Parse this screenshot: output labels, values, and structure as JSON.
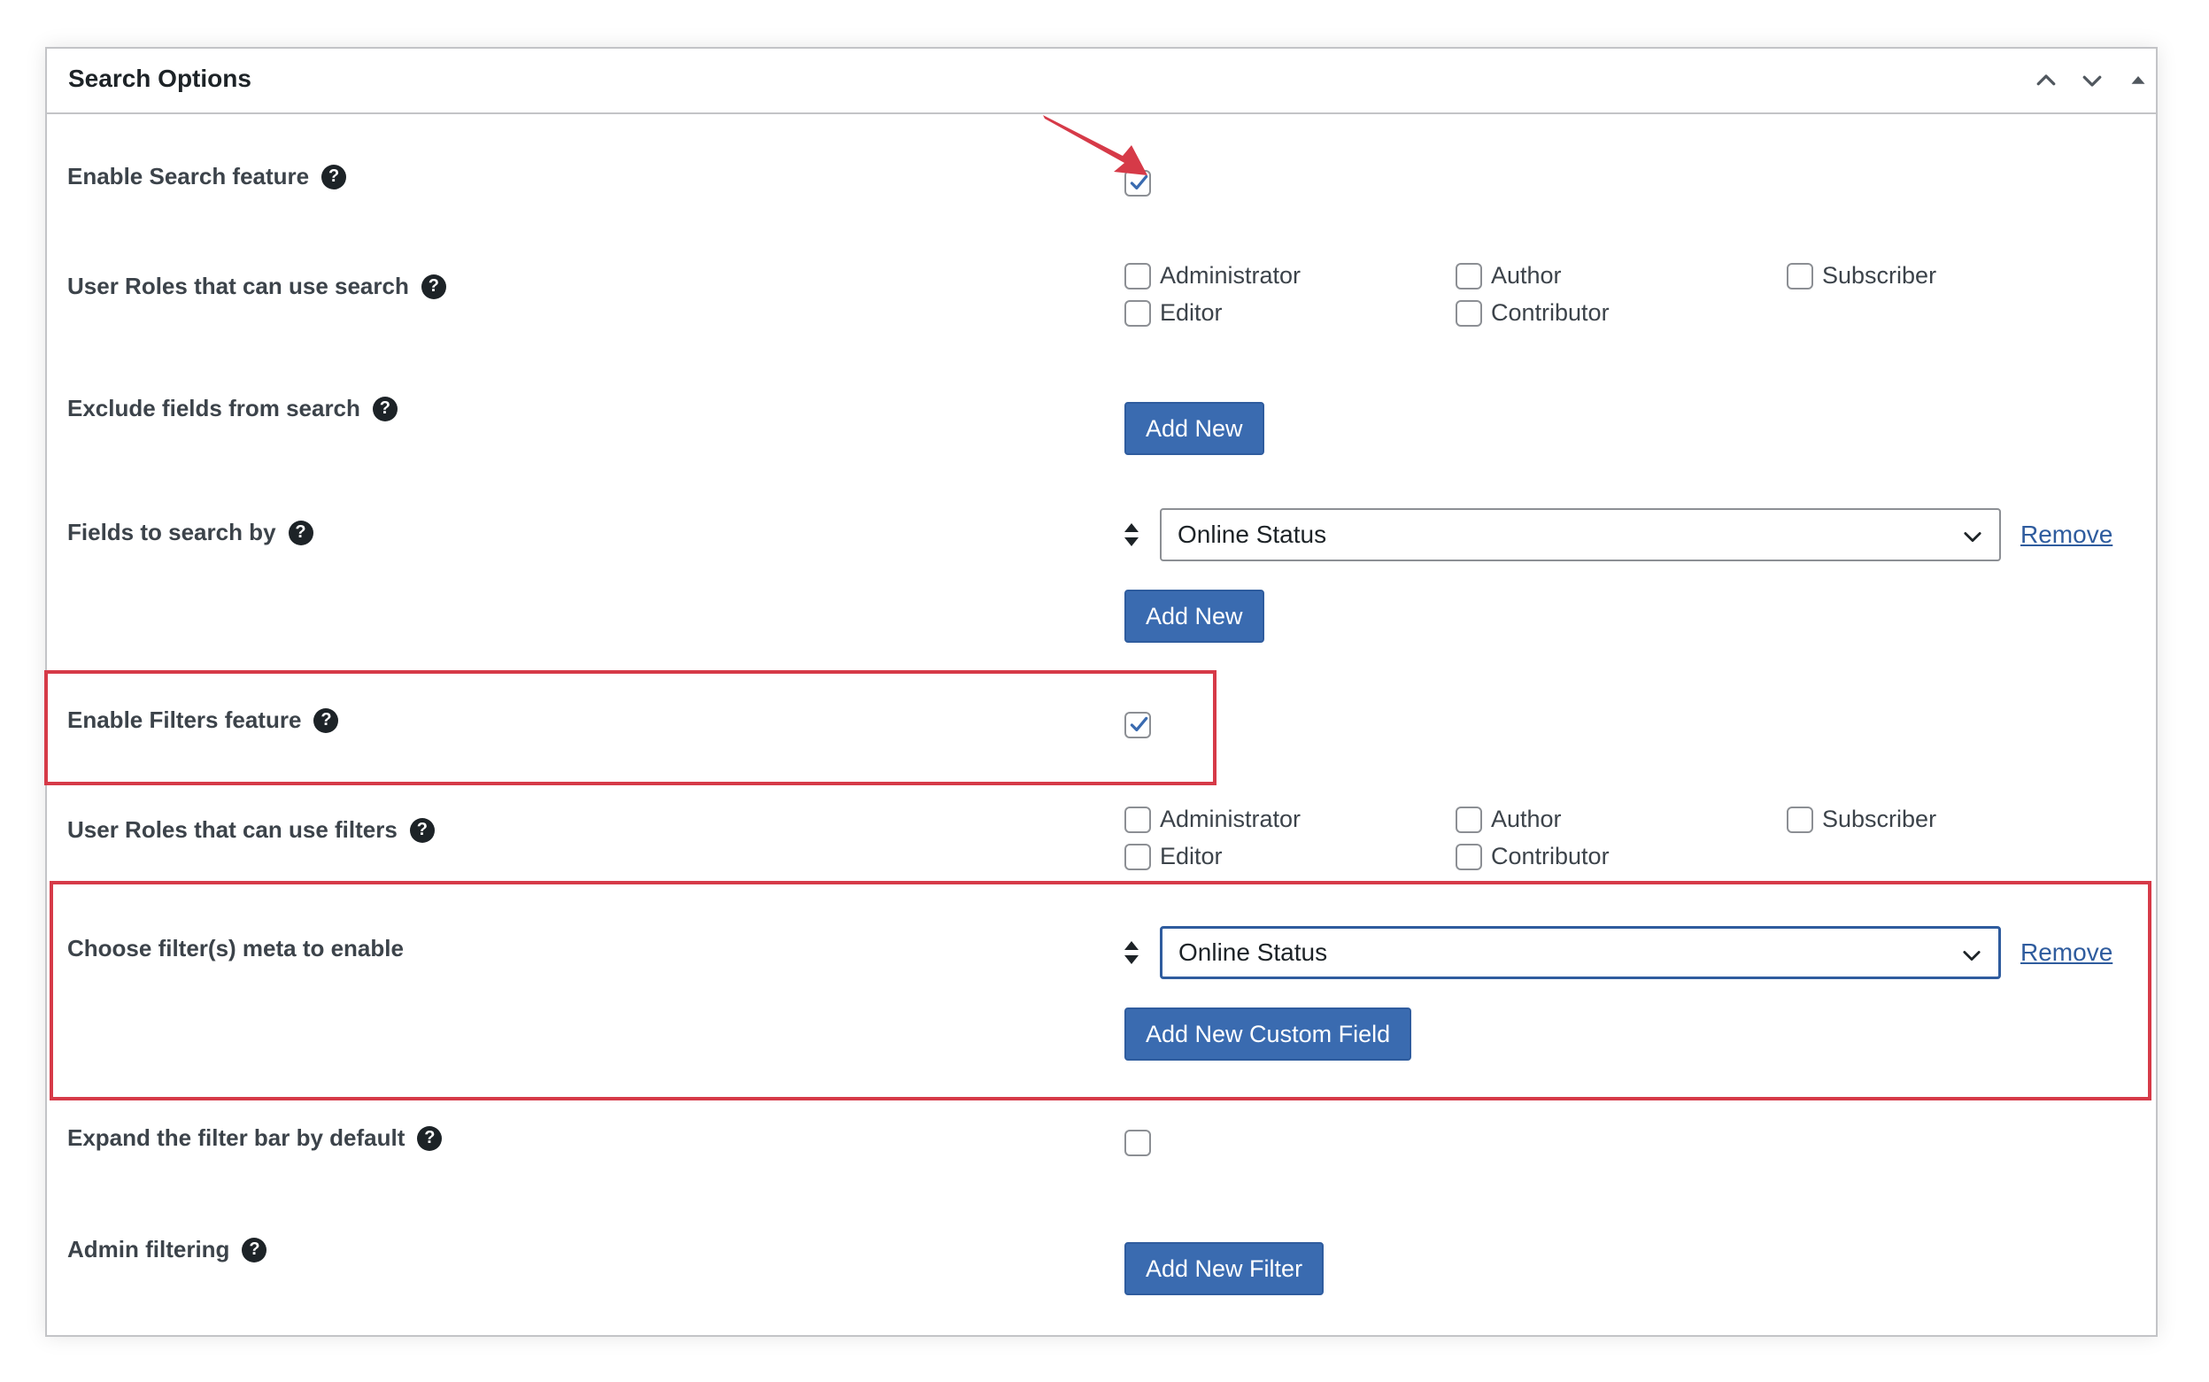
{
  "panel": {
    "title": "Search Options"
  },
  "rows": {
    "enable_search": {
      "label": "Enable Search feature",
      "checked": true
    },
    "roles_search": {
      "label": "User Roles that can use search",
      "options": [
        "Administrator",
        "Author",
        "Subscriber",
        "Editor",
        "Contributor"
      ]
    },
    "exclude_fields": {
      "label": "Exclude fields from search",
      "button": "Add New"
    },
    "fields_search": {
      "label": "Fields to search by",
      "select_value": "Online Status",
      "remove": "Remove",
      "button": "Add New"
    },
    "enable_filters": {
      "label": "Enable Filters feature",
      "checked": true
    },
    "roles_filters": {
      "label": "User Roles that can use filters",
      "options": [
        "Administrator",
        "Author",
        "Subscriber",
        "Editor",
        "Contributor"
      ]
    },
    "filter_meta": {
      "label": "Choose filter(s) meta to enable",
      "select_value": "Online Status",
      "remove": "Remove",
      "button": "Add New Custom Field"
    },
    "expand_filter": {
      "label": "Expand the filter bar by default",
      "checked": false
    },
    "admin_filtering": {
      "label": "Admin filtering",
      "button": "Add New Filter"
    }
  },
  "help_glyph": "?",
  "colors": {
    "button": "#3a6bb0",
    "highlight": "#d63a48",
    "link": "#2f5c9e"
  }
}
